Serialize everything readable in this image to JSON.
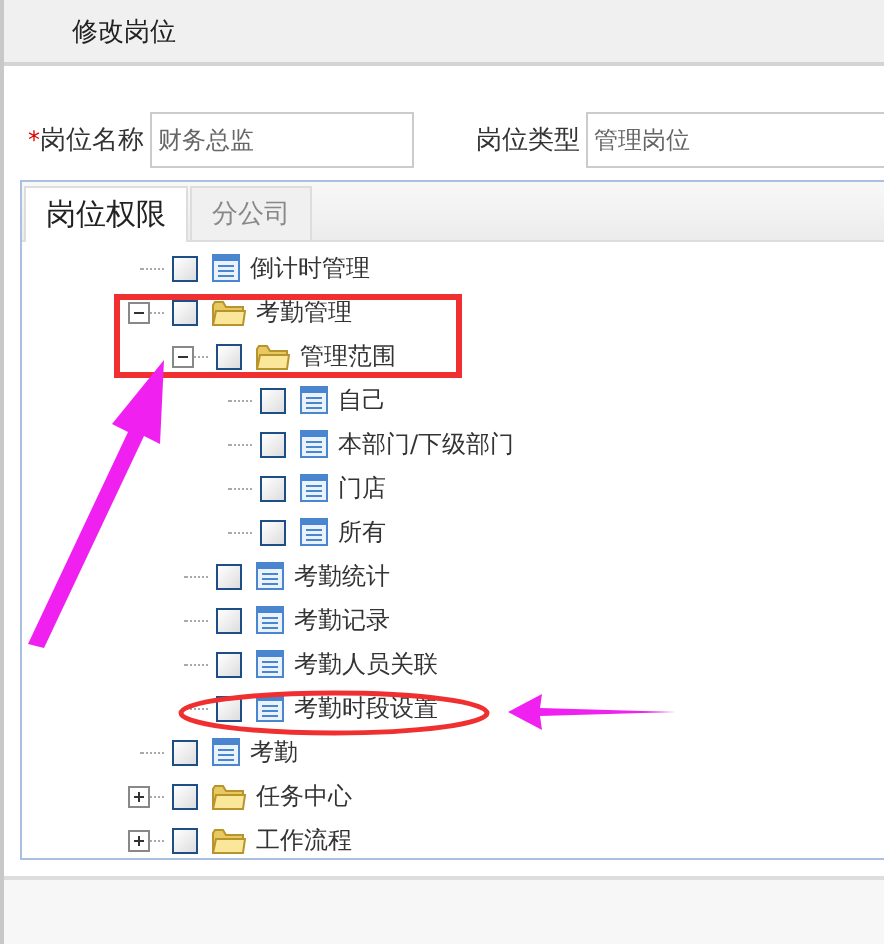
{
  "header": {
    "title": "修改岗位"
  },
  "form": [
    {
      "mark": "*",
      "label": "岗位名称",
      "value": "财务总监"
    },
    {
      "label": "岗位类型",
      "value": "管理岗位"
    }
  ],
  "tabs": [
    {
      "label": "岗位权限",
      "selected": true
    },
    {
      "label": "分公司",
      "selected": false
    }
  ],
  "tree": [
    {
      "label": "倒计时管理",
      "kind": "page",
      "checked": false
    },
    {
      "label": "考勤管理",
      "kind": "folder",
      "expanded": true,
      "checked": false,
      "children": [
        {
          "label": "管理范围",
          "kind": "folder",
          "expanded": true,
          "checked": false,
          "children": [
            {
              "label": "自己",
              "kind": "page",
              "checked": false
            },
            {
              "label": "本部门/下级部门",
              "kind": "page",
              "checked": false
            },
            {
              "label": "门店",
              "kind": "page",
              "checked": false
            },
            {
              "label": "所有",
              "kind": "page",
              "checked": false
            }
          ]
        },
        {
          "label": "考勤统计",
          "kind": "page",
          "checked": false
        },
        {
          "label": "考勤记录",
          "kind": "page",
          "checked": false
        },
        {
          "label": "考勤人员关联",
          "kind": "page",
          "checked": false
        },
        {
          "label": "考勤时段设置",
          "kind": "page",
          "checked": false
        }
      ]
    },
    {
      "label": "考勤",
      "kind": "page",
      "checked": false
    },
    {
      "label": "任务中心",
      "kind": "folder",
      "expanded": false,
      "checked": false
    },
    {
      "label": "工作流程",
      "kind": "folder",
      "expanded": false,
      "checked": false
    }
  ]
}
